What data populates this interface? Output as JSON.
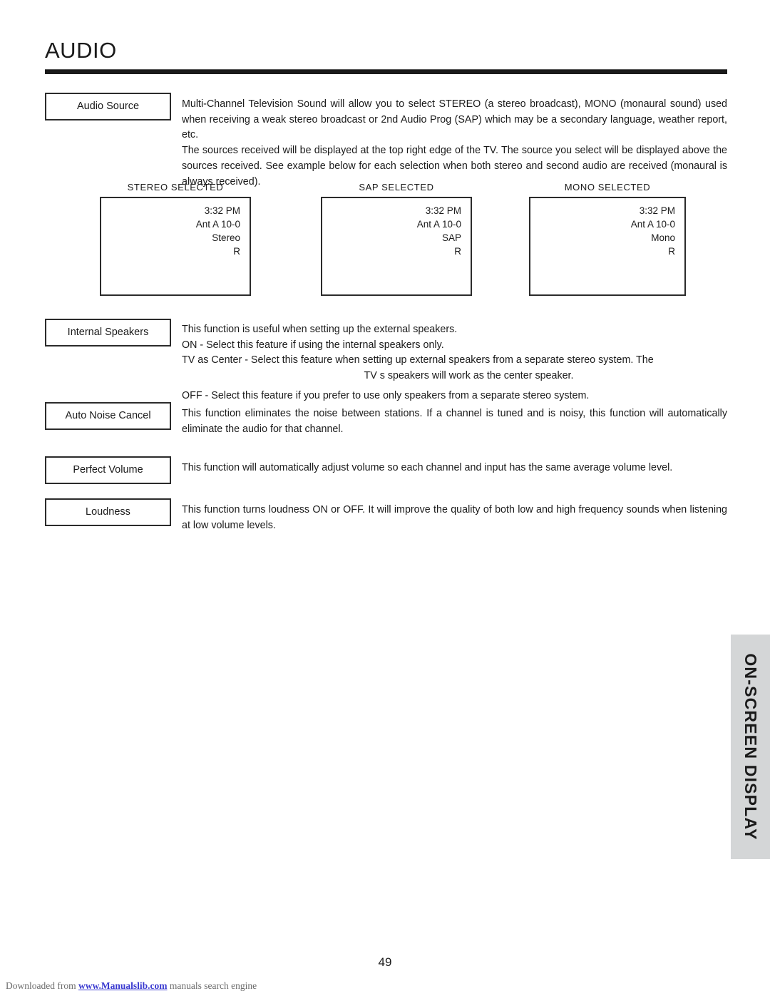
{
  "document": {
    "title": "AUDIO",
    "page_number": "49"
  },
  "sections": [
    {
      "label": "Audio Source",
      "paragraphs": [
        "Multi-Channel Television Sound will allow you to select STEREO (a stereo broadcast), MONO (monaural sound) used when receiving a weak stereo broadcast or 2nd Audio Prog (SAP) which may be a secondary language, weather report, etc.",
        "The sources received will be displayed at the top right edge of the TV.  The source you select will be displayed above the sources received.  See example below for each selection when both stereo and second audio are received (monaural is always received)."
      ]
    },
    {
      "label": "Internal Speakers",
      "paragraphs": [
        "This function is useful when setting up the external speakers.",
        "ON - Select this feature if using the internal speakers only.",
        "TV as Center - Select this feature when setting up external speakers from a separate stereo system.  The",
        "TV s speakers will work as the center speaker.",
        "OFF - Select this feature if you prefer to use only speakers from a separate stereo system."
      ]
    },
    {
      "label": "Auto Noise Cancel",
      "paragraphs": [
        "This function eliminates the noise between stations. If a channel is tuned and is noisy, this function will automatically eliminate the audio for that channel."
      ]
    },
    {
      "label": "Perfect Volume",
      "paragraphs": [
        "This function will automatically adjust volume so each channel  and input has the same average volume level."
      ]
    },
    {
      "label": "Loudness",
      "paragraphs": [
        "This function turns loudness ON or OFF.  It will improve the quality of both low and high frequency sounds when listening at low volume levels."
      ]
    }
  ],
  "tv_examples": [
    {
      "caption": "STEREO SELECTED",
      "lines": [
        "3:32 PM",
        "Ant A 10-0",
        "Stereo",
        "R"
      ]
    },
    {
      "caption": "SAP SELECTED",
      "lines": [
        "3:32 PM",
        "Ant A 10-0",
        "SAP",
        "R"
      ]
    },
    {
      "caption": "MONO SELECTED",
      "lines": [
        "3:32 PM",
        "Ant A 10-0",
        "Mono",
        "R"
      ]
    }
  ],
  "side_tab": {
    "label": "ON-SCREEN DISPLAY",
    "background_color": "#d4d6d7"
  },
  "footer": {
    "prefix": "Downloaded from ",
    "link": "www.Manualslib.com",
    "suffix": " manuals search engine",
    "link_color": "#3a3ad0"
  }
}
